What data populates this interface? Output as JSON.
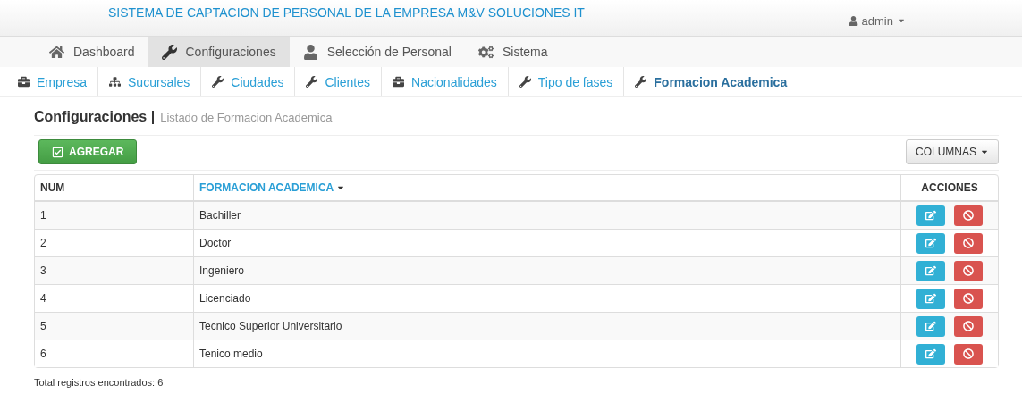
{
  "header": {
    "title": "SISTEMA DE CAPTACION DE PERSONAL DE LA EMPRESA M&V SOLUCIONES IT",
    "user": "admin"
  },
  "main_nav": [
    {
      "label": "Dashboard",
      "selected": false
    },
    {
      "label": "Configuraciones",
      "selected": true
    },
    {
      "label": "Selección de Personal",
      "selected": false
    },
    {
      "label": "Sistema",
      "selected": false
    }
  ],
  "sub_nav": [
    {
      "label": "Empresa",
      "selected": false
    },
    {
      "label": "Sucursales",
      "selected": false
    },
    {
      "label": "Ciudades",
      "selected": false
    },
    {
      "label": "Clientes",
      "selected": false
    },
    {
      "label": "Nacionalidades",
      "selected": false
    },
    {
      "label": "Tipo de fases",
      "selected": false
    },
    {
      "label": "Formacion Academica",
      "selected": true
    }
  ],
  "page_title": {
    "title": "Configuraciones |",
    "subtitle": "Listado de Formacion Academica"
  },
  "toolbar": {
    "add_button": "AGREGAR",
    "columns_button": "COLUMNAS"
  },
  "table": {
    "columns": [
      {
        "label": "NUM",
        "sortable": false
      },
      {
        "label": "FORMACION ACADEMICA",
        "sortable": true
      },
      {
        "label": "ACCIONES",
        "sortable": false
      }
    ],
    "rows": [
      {
        "num": "1",
        "name": "Bachiller"
      },
      {
        "num": "2",
        "name": "Doctor"
      },
      {
        "num": "3",
        "name": "Ingeniero"
      },
      {
        "num": "4",
        "name": "Licenciado"
      },
      {
        "num": "5",
        "name": "Tecnico Superior Universitario"
      },
      {
        "num": "6",
        "name": "Tenico medio"
      }
    ]
  },
  "footer": {
    "total": "Total registros encontrados: 6"
  }
}
